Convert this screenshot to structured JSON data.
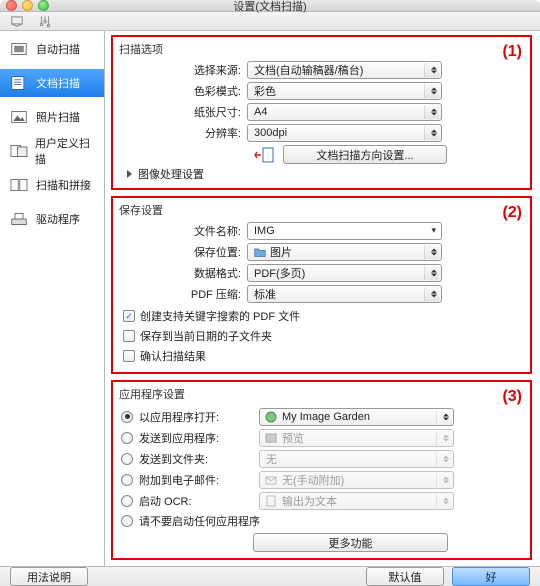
{
  "window": {
    "title": "设置(文档扫描)"
  },
  "sidebar": {
    "items": [
      {
        "label": "自动扫描",
        "icon": "auto"
      },
      {
        "label": "文档扫描",
        "icon": "doc",
        "selected": true
      },
      {
        "label": "照片扫描",
        "icon": "photo"
      },
      {
        "label": "用户定义扫描",
        "icon": "custom"
      },
      {
        "label": "扫描和拼接",
        "icon": "stitch"
      },
      {
        "label": "驱动程序",
        "icon": "driver"
      }
    ]
  },
  "annotations": {
    "a1": "(1)",
    "a2": "(2)",
    "a3": "(3)"
  },
  "scan_options": {
    "title": "扫描选项",
    "source_label": "选择来源:",
    "source_value": "文档(自动输稿器/稿台)",
    "color_label": "色彩模式:",
    "color_value": "彩色",
    "paper_label": "纸张尺寸:",
    "paper_value": "A4",
    "dpi_label": "分辨率:",
    "dpi_value": "300dpi",
    "orient_button": "文档扫描方向设置...",
    "image_processing": "图像处理设置"
  },
  "save_settings": {
    "title": "保存设置",
    "filename_label": "文件名称:",
    "filename_value": "IMG",
    "location_label": "保存位置:",
    "location_value": "图片",
    "format_label": "数据格式:",
    "format_value": "PDF(多页)",
    "compress_label": "PDF 压缩:",
    "compress_value": "标准",
    "chk_keyword": "创建支持关键字搜索的 PDF 文件",
    "chk_subfolder": "保存到当前日期的子文件夹",
    "chk_confirm": "确认扫描结果"
  },
  "app_settings": {
    "title": "应用程序设置",
    "open_with_label": "以应用程序打开:",
    "open_with_value": "My Image Garden",
    "send_app_label": "发送到应用程序:",
    "send_app_value": "预览",
    "send_folder_label": "发送到文件夹:",
    "send_folder_value": "无",
    "attach_email_label": "附加到电子邮件:",
    "attach_email_value": "无(手动附加)",
    "ocr_label": "启动 OCR:",
    "ocr_value": "输出为文本",
    "none_label": "请不要启动任何应用程序",
    "more_button": "更多功能"
  },
  "footer": {
    "instructions": "用法说明",
    "defaults": "默认值",
    "ok": "好"
  }
}
